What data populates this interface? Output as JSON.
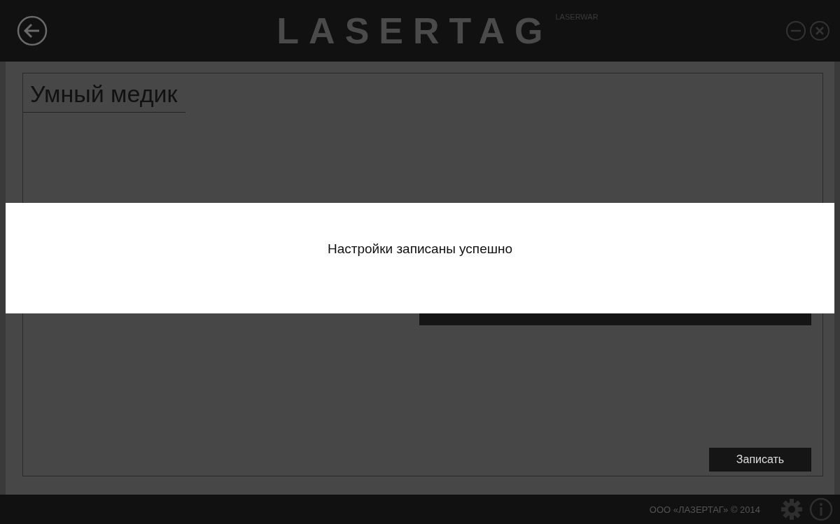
{
  "header": {
    "logo": "LASERTAG",
    "brand": "LASERWAR"
  },
  "page": {
    "title": "Умный медик",
    "save_button": "Записать"
  },
  "dialog": {
    "message": "Настройки записаны успешно"
  },
  "footer": {
    "copyright": "ООО «ЛАЗЕРТАГ» © 2014"
  }
}
